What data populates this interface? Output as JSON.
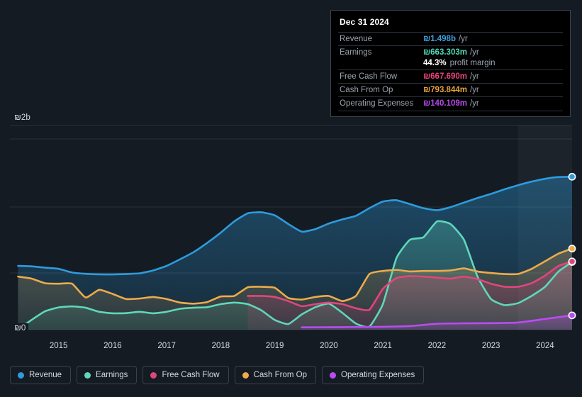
{
  "background_color": "#141b23",
  "axes": {
    "y_top_label": "₪2b",
    "y_bottom_label": "₪0",
    "x_ticks": [
      "2015",
      "2016",
      "2017",
      "2018",
      "2019",
      "2020",
      "2021",
      "2022",
      "2023",
      "2024"
    ]
  },
  "tooltip": {
    "date": "Dec 31 2024",
    "rows": [
      {
        "label": "Revenue",
        "value": "₪1.498b",
        "unit": "/yr",
        "color": "#3aa0e0"
      },
      {
        "label": "Earnings",
        "value": "₪663.303m",
        "unit": "/yr",
        "color": "#4fd9b8"
      },
      {
        "label": "Free Cash Flow",
        "value": "₪667.690m",
        "unit": "/yr",
        "color": "#e8447d"
      },
      {
        "label": "Cash From Op",
        "value": "₪793.844m",
        "unit": "/yr",
        "color": "#e8a33d"
      },
      {
        "label": "Operating Expenses",
        "value": "₪140.109m",
        "unit": "/yr",
        "color": "#b44ae8"
      }
    ],
    "profit_margin": {
      "value": "44.3%",
      "text": "profit margin"
    }
  },
  "legend": {
    "items": [
      {
        "label": "Revenue",
        "color": "#2e9bdb"
      },
      {
        "label": "Earnings",
        "color": "#5fd7bb"
      },
      {
        "label": "Free Cash Flow",
        "color": "#e0467e"
      },
      {
        "label": "Cash From Op",
        "color": "#edab4a"
      },
      {
        "label": "Operating Expenses",
        "color": "#b94cf0"
      }
    ]
  },
  "chart_data": {
    "type": "area",
    "title": "",
    "xlabel": "",
    "ylabel": "",
    "xlim": [
      2014.6,
      2025.0
    ],
    "ylim": [
      0,
      2000
    ],
    "y_unit": "ILS millions",
    "grid": true,
    "legend_position": "bottom",
    "highlight_band": {
      "from": 2024.0,
      "to": 2025.0
    },
    "series": [
      {
        "name": "Revenue",
        "color": "#2e9bdb",
        "x": [
          2014.75,
          2015.0,
          2015.25,
          2015.5,
          2015.75,
          2016.0,
          2016.25,
          2016.5,
          2016.75,
          2017.0,
          2017.25,
          2017.5,
          2017.75,
          2018.0,
          2018.25,
          2018.5,
          2018.75,
          2019.0,
          2019.25,
          2019.5,
          2019.75,
          2020.0,
          2020.25,
          2020.5,
          2020.75,
          2021.0,
          2021.25,
          2021.5,
          2021.75,
          2022.0,
          2022.25,
          2022.5,
          2022.75,
          2023.0,
          2023.25,
          2023.5,
          2023.75,
          2024.0,
          2024.25,
          2024.5,
          2024.75,
          2025.0
        ],
        "values": [
          625,
          620,
          607,
          596,
          560,
          547,
          542,
          541,
          545,
          552,
          580,
          625,
          690,
          760,
          850,
          950,
          1060,
          1140,
          1150,
          1120,
          1035,
          960,
          985,
          1040,
          1080,
          1115,
          1190,
          1255,
          1268,
          1230,
          1190,
          1170,
          1200,
          1245,
          1290,
          1330,
          1375,
          1415,
          1450,
          1478,
          1495,
          1498
        ]
      },
      {
        "name": "Earnings",
        "color": "#5fd7bb",
        "x": [
          2014.75,
          2015.0,
          2015.25,
          2015.5,
          2015.75,
          2016.0,
          2016.25,
          2016.5,
          2016.75,
          2017.0,
          2017.25,
          2017.5,
          2017.75,
          2018.0,
          2018.25,
          2018.5,
          2018.75,
          2019.0,
          2019.25,
          2019.5,
          2019.75,
          2020.0,
          2020.25,
          2020.5,
          2020.75,
          2021.0,
          2021.25,
          2021.5,
          2021.75,
          2022.0,
          2022.25,
          2022.5,
          2022.75,
          2023.0,
          2023.25,
          2023.5,
          2023.75,
          2024.0,
          2024.25,
          2024.5,
          2024.75,
          2025.0
        ],
        "values": [
          0,
          95,
          180,
          218,
          228,
          215,
          175,
          160,
          162,
          175,
          160,
          175,
          205,
          215,
          220,
          250,
          265,
          250,
          190,
          95,
          55,
          150,
          220,
          255,
          165,
          60,
          30,
          250,
          700,
          880,
          905,
          1060,
          1035,
          880,
          520,
          300,
          240,
          260,
          330,
          420,
          570,
          663
        ]
      },
      {
        "name": "Free Cash Flow",
        "color": "#e0467e",
        "x": [
          2019.0,
          2019.25,
          2019.5,
          2019.75,
          2020.0,
          2020.25,
          2020.5,
          2020.75,
          2021.0,
          2021.25,
          2021.5,
          2021.75,
          2022.0,
          2022.25,
          2022.5,
          2022.75,
          2023.0,
          2023.25,
          2023.5,
          2023.75,
          2024.0,
          2024.25,
          2024.5,
          2024.75,
          2025.0
        ],
        "values": [
          330,
          330,
          320,
          280,
          230,
          250,
          265,
          250,
          210,
          195,
          400,
          505,
          525,
          520,
          510,
          500,
          520,
          495,
          450,
          420,
          420,
          455,
          530,
          625,
          668
        ]
      },
      {
        "name": "Cash From Op",
        "color": "#edab4a",
        "x": [
          2014.75,
          2015.0,
          2015.25,
          2015.5,
          2015.75,
          2016.0,
          2016.25,
          2016.5,
          2016.75,
          2017.0,
          2017.25,
          2017.5,
          2017.75,
          2018.0,
          2018.25,
          2018.5,
          2018.75,
          2019.0,
          2019.25,
          2019.5,
          2019.75,
          2020.0,
          2020.25,
          2020.5,
          2020.75,
          2021.0,
          2021.25,
          2021.5,
          2021.75,
          2022.0,
          2022.25,
          2022.5,
          2022.75,
          2023.0,
          2023.25,
          2023.5,
          2023.75,
          2024.0,
          2024.25,
          2024.5,
          2024.75,
          2025.0
        ],
        "values": [
          520,
          500,
          455,
          450,
          450,
          315,
          390,
          350,
          300,
          305,
          320,
          300,
          265,
          255,
          270,
          325,
          330,
          415,
          420,
          410,
          310,
          295,
          320,
          330,
          280,
          330,
          545,
          575,
          585,
          570,
          575,
          575,
          580,
          600,
          570,
          555,
          545,
          545,
          595,
          670,
          745,
          794
        ]
      },
      {
        "name": "Operating Expenses",
        "color": "#b94cf0",
        "x": [
          2020.0,
          2020.5,
          2021.0,
          2021.5,
          2022.0,
          2022.5,
          2023.0,
          2023.5,
          2024.0,
          2024.5,
          2025.0
        ],
        "values": [
          23,
          24,
          26,
          28,
          35,
          58,
          62,
          64,
          70,
          105,
          140
        ]
      }
    ]
  }
}
